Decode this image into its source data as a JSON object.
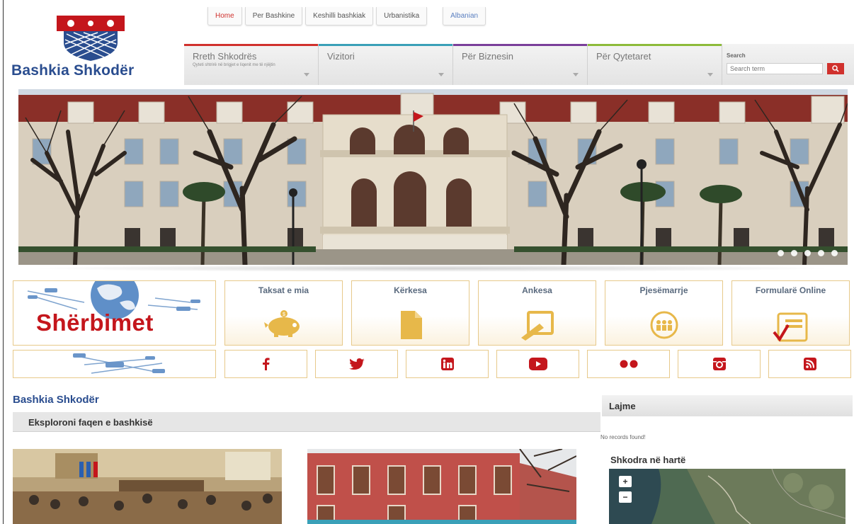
{
  "brand": {
    "name": "Bashkia Shkodër"
  },
  "top_nav": {
    "home": "Home",
    "tabs": [
      "Per Bashkine",
      "Keshilli bashkiak",
      "Urbanistika"
    ],
    "language": "Albanian"
  },
  "main_nav": {
    "items": [
      {
        "label": "Rreth Shkodrës",
        "sub": "Qyteti shtrirë në brigjet e liqenit me të njëjtin",
        "color": "#d0312d"
      },
      {
        "label": "Vizitori",
        "sub": "",
        "color": "#3aa0b8"
      },
      {
        "label": "Për Biznesin",
        "sub": "",
        "color": "#7a3f9a"
      },
      {
        "label": "Për Qytetaret",
        "sub": "",
        "color": "#8dbb3a"
      }
    ],
    "search": {
      "label": "Search",
      "placeholder": "Search term"
    }
  },
  "hero": {
    "slide_count": 5,
    "active_slide": 1
  },
  "services": {
    "banner": "Shërbimet",
    "tiles": [
      {
        "label": "Taksat e mia",
        "icon": "piggy-bank-icon"
      },
      {
        "label": "Kërkesa",
        "icon": "document-icon"
      },
      {
        "label": "Ankesa",
        "icon": "edit-note-icon"
      },
      {
        "label": "Pjesëmarrje",
        "icon": "people-icon"
      },
      {
        "label": "Formularë Online",
        "icon": "form-check-icon"
      }
    ]
  },
  "social": [
    {
      "name": "facebook-icon"
    },
    {
      "name": "twitter-icon"
    },
    {
      "name": "linkedin-icon"
    },
    {
      "name": "youtube-icon"
    },
    {
      "name": "flickr-icon"
    },
    {
      "name": "instagram-icon"
    },
    {
      "name": "rss-icon"
    }
  ],
  "content": {
    "title": "Bashkia Shkodër",
    "explore": "Eksploroni faqen e bashkisë"
  },
  "sidebar": {
    "news_title": "Lajme",
    "no_records": "No records found!",
    "map_title": "Shkodra në hartë",
    "zoom_in": "+",
    "zoom_out": "−"
  },
  "colors": {
    "brand_blue": "#2a4d8f",
    "brand_red": "#c4161c",
    "tile_gold": "#e7b84a",
    "social_red": "#c4161c"
  }
}
